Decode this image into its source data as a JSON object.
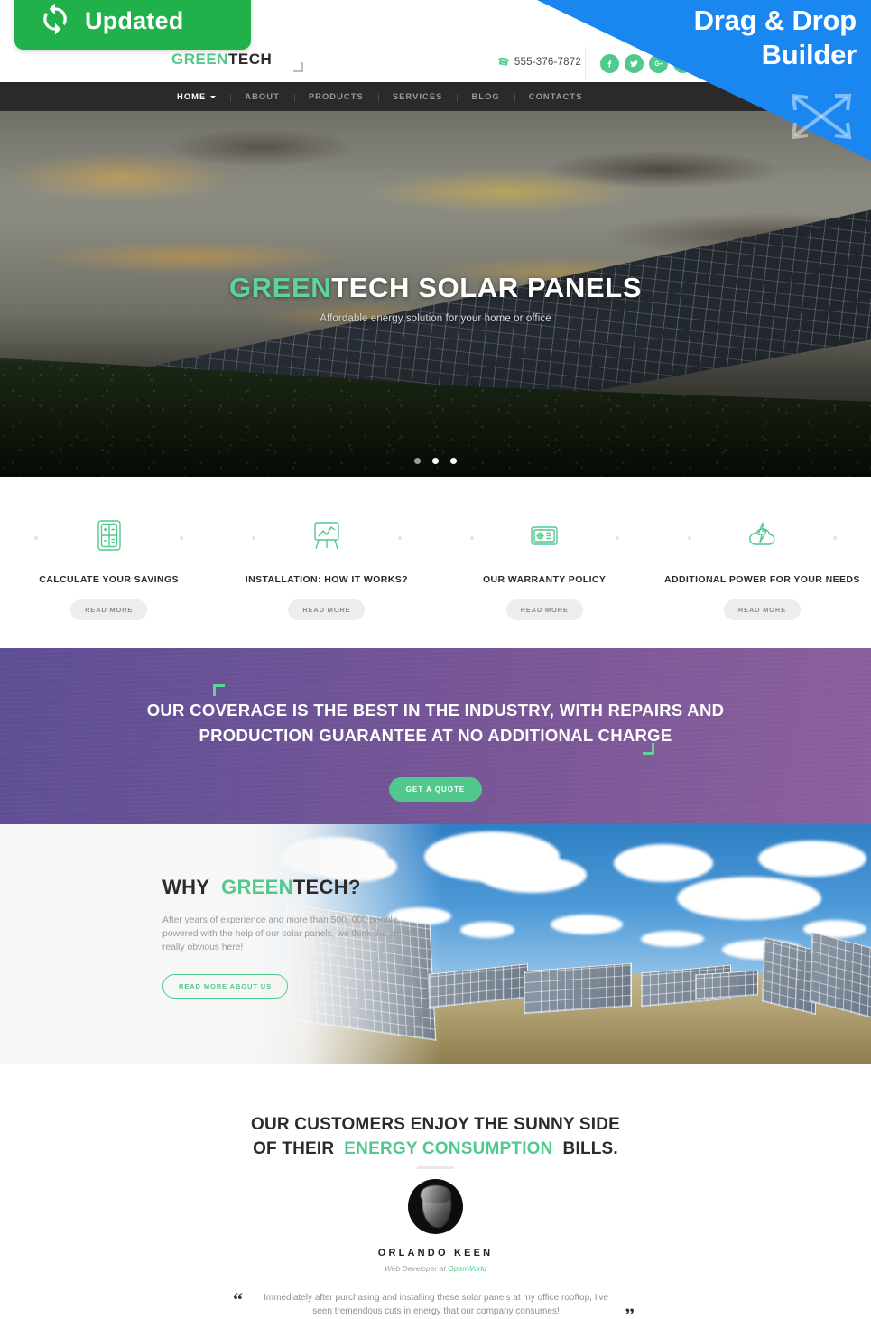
{
  "badges": {
    "updated_label": "Updated",
    "updated_icon": "refresh-icon",
    "dragdrop_line1": "Drag & Drop",
    "dragdrop_line2": "Builder",
    "dragdrop_icon": "four-way-arrow-icon",
    "updated_color": "#21b14b",
    "dragdrop_color": "#1a86f0"
  },
  "header": {
    "logo_green": "GREEN",
    "logo_dark": "TECH",
    "phone": "555-376-7872",
    "phone_icon": "phone-icon",
    "socials": [
      {
        "name": "facebook-icon",
        "glyph": "f"
      },
      {
        "name": "twitter-icon",
        "glyph": "t"
      },
      {
        "name": "google-plus-icon",
        "glyph": "G+"
      },
      {
        "name": "linkedin-icon",
        "glyph": "in"
      }
    ]
  },
  "nav": {
    "items": [
      {
        "label": "HOME",
        "active": true,
        "has_dropdown": true
      },
      {
        "label": "ABOUT",
        "active": false,
        "has_dropdown": false
      },
      {
        "label": "PRODUCTS",
        "active": false,
        "has_dropdown": false
      },
      {
        "label": "SERVICES",
        "active": false,
        "has_dropdown": false
      },
      {
        "label": "BLOG",
        "active": false,
        "has_dropdown": false
      },
      {
        "label": "CONTACTS",
        "active": false,
        "has_dropdown": false
      }
    ]
  },
  "hero": {
    "title_green": "GREEN",
    "title_rest": "TECH SOLAR PANELS",
    "subtitle": "Affordable energy solution for your home or office",
    "slides_total": 3,
    "active_slide": 1
  },
  "features": [
    {
      "icon": "calculator-icon",
      "title": "CALCULATE YOUR SAVINGS",
      "button": "READ MORE"
    },
    {
      "icon": "chart-easel-icon",
      "title": "INSTALLATION: HOW IT WORKS?",
      "button": "READ MORE"
    },
    {
      "icon": "warranty-box-icon",
      "title": "OUR WARRANTY POLICY",
      "button": "READ MORE"
    },
    {
      "icon": "cloud-lightning-icon",
      "title": "ADDITIONAL POWER FOR YOUR NEEDS",
      "button": "READ MORE"
    }
  ],
  "cta": {
    "line1": "OUR COVERAGE IS THE BEST IN THE INDUSTRY, WITH REPAIRS AND",
    "line2": "PRODUCTION GUARANTEE AT NO ADDITIONAL CHARGE",
    "button": "GET A QUOTE",
    "accent_color": "#52c98c",
    "background_color": "#6e5498"
  },
  "why": {
    "title_plain": "WHY",
    "title_green": "GREEN",
    "title_rest": "TECH?",
    "body": "After years of experience and more than 500, 000 people powered with the help of our solar panels, we think the choice is really obvious here!",
    "button": "READ MORE ABOUT US"
  },
  "testimonials": {
    "heading_line1": "OUR CUSTOMERS ENJOY THE SUNNY SIDE",
    "heading_line2_pre": "OF THEIR",
    "heading_line2_green": "ENERGY CONSUMPTION",
    "heading_line2_post": "BILLS.",
    "author_name": "ORLANDO KEEN",
    "author_role_pre": "Web Developer at",
    "author_role_company": "OpenWorld",
    "quote": "Immediately after purchasing and installing these solar panels at my office rooftop, I've seen tremendous cuts in energy that our company consumes!",
    "quote_open_glyph": "“",
    "quote_close_glyph": "”"
  }
}
